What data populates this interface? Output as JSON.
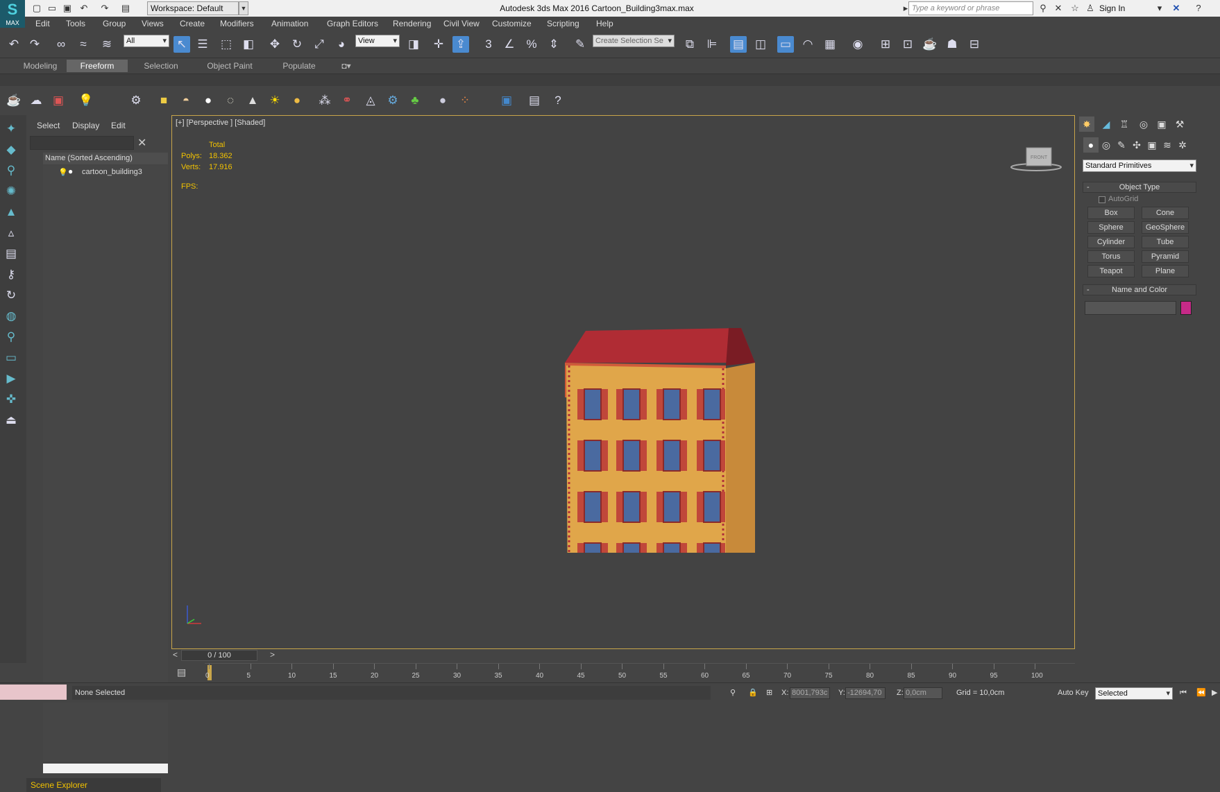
{
  "titlebar": {
    "app_title": "Autodesk 3ds Max 2016    Cartoon_Building3max.max",
    "workspace": "Workspace: Default",
    "search_placeholder": "Type a keyword or phrase",
    "sign_in": "Sign In",
    "logo_text": "MAX"
  },
  "menu": [
    "Edit",
    "Tools",
    "Group",
    "Views",
    "Create",
    "Modifiers",
    "Animation",
    "Graph Editors",
    "Rendering",
    "Civil View",
    "Customize",
    "Scripting",
    "Help"
  ],
  "main_toolbar": {
    "selection_filter": "All",
    "ref_coord": "View",
    "named_selection_placeholder": "Create Selection Se",
    "snap_value": "3"
  },
  "ribbon_tabs": [
    "Modeling",
    "Freeform",
    "Selection",
    "Object Paint",
    "Populate"
  ],
  "ribbon_selected": "Freeform",
  "scene_explorer": {
    "tabs": [
      "Select",
      "Display",
      "Edit"
    ],
    "column_header": "Name (Sorted Ascending)",
    "items": [
      "cartoon_building3"
    ],
    "footer": "Scene Explorer"
  },
  "viewport": {
    "label": "[+] [Perspective ] [Shaded]",
    "stats_header": "Total",
    "polys_label": "Polys:",
    "polys_value": "18.362",
    "verts_label": "Verts:",
    "verts_value": "17.916",
    "fps_label": "FPS:",
    "viewcube_text": "FRONT"
  },
  "command_panel": {
    "category": "Standard Primitives",
    "rollout_object_type": "Object Type",
    "autogrid": "AutoGrid",
    "buttons": [
      "Box",
      "Cone",
      "Sphere",
      "GeoSphere",
      "Cylinder",
      "Tube",
      "Torus",
      "Pyramid",
      "Teapot",
      "Plane"
    ],
    "rollout_name_color": "Name and Color",
    "object_color": "#c62a88"
  },
  "timeline": {
    "frame_display": "0 / 100",
    "ticks": [
      "0",
      "5",
      "10",
      "15",
      "20",
      "25",
      "30",
      "35",
      "40",
      "45",
      "50",
      "55",
      "60",
      "65",
      "70",
      "75",
      "80",
      "85",
      "90",
      "95",
      "100"
    ]
  },
  "status": {
    "selection": "None Selected",
    "x_label": "X:",
    "x_value": "8001,793c",
    "y_label": "Y:",
    "y_value": "-12694,70",
    "z_label": "Z:",
    "z_value": "0,0cm",
    "grid": "Grid = 10,0cm",
    "auto_key": "Auto Key",
    "key_filter": "Selected"
  },
  "colors": {
    "accent": "#f2c200",
    "active_button": "#4a8ad0",
    "viewport_border": "#c9a64a",
    "building_wall": "#e0a64a",
    "building_roof": "#b02c34"
  }
}
